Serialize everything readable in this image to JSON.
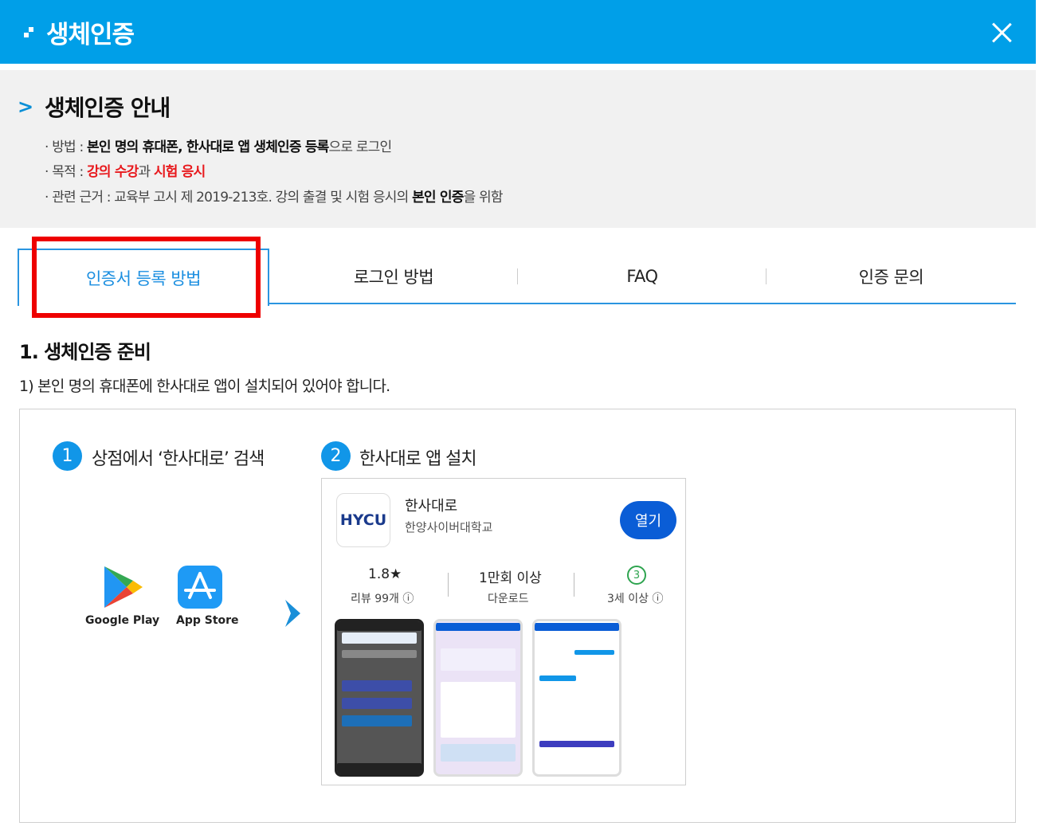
{
  "header": {
    "title": "생체인증",
    "close_label": "×"
  },
  "guide": {
    "title": "생체인증 안내",
    "method": {
      "prefix": "· 방법 : ",
      "bold": "본인 명의 휴대폰, 한사대로 앱 생체인증 등록",
      "suffix": "으로 로그인"
    },
    "purpose": {
      "prefix": "· 목적 : ",
      "red1": "강의 수강",
      "mid": "과 ",
      "red2": "시험 응시"
    },
    "basis": {
      "prefix": "· 관련 근거 : 교육부 고시 제 2019-213호. 강의 출결 및 시험 응시의 ",
      "bold": "본인 인증",
      "suffix": "을 위함"
    }
  },
  "tabs": [
    {
      "label": "인증서 등록 방법",
      "active": true
    },
    {
      "label": "로그인 방법",
      "active": false
    },
    {
      "label": "FAQ",
      "active": false
    },
    {
      "label": "인증 문의",
      "active": false
    }
  ],
  "section": {
    "title": "1. 생체인증 준비",
    "subtitle": "1) 본인 명의 휴대폰에 한사대로 앱이 설치되어 있어야 합니다."
  },
  "steps": [
    {
      "num": "1",
      "text": "상점에서 ‘한사대로’ 검색"
    },
    {
      "num": "2",
      "text": "한사대로 앱 설치"
    }
  ],
  "stores": [
    {
      "label": "Google Play",
      "icon": "google-play-icon"
    },
    {
      "label": "App Store",
      "icon": "app-store-icon"
    }
  ],
  "app": {
    "logo_text": "HYCU",
    "name": "한사대로",
    "developer": "한양사이버대학교",
    "open_label": "열기",
    "rating": "1.8★",
    "reviews": "리뷰 99개 ⓘ",
    "downloads": "1만회 이상",
    "downloads_label": "다운로드",
    "age_badge": "3",
    "age": "3세 이상 ⓘ"
  },
  "colors": {
    "header": "#009fe8",
    "accent": "#2a95e0",
    "highlight": "#ee0000",
    "red_text": "#e8191d",
    "open_button": "#0a5dd6"
  }
}
